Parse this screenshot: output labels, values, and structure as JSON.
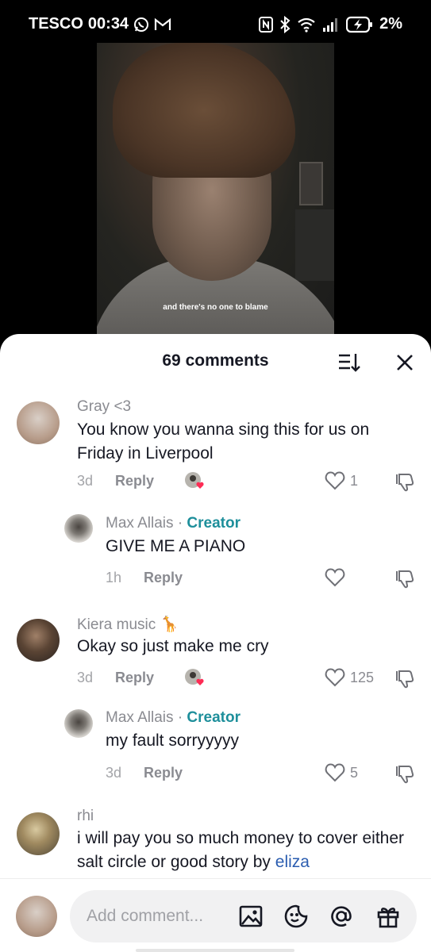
{
  "status_bar": {
    "carrier": "TESCO",
    "time": "00:34",
    "left_icons": [
      "whatsapp-icon",
      "gmail-icon"
    ],
    "right_icons": [
      "nfc-icon",
      "bluetooth-icon",
      "wifi-icon",
      "signal-icon",
      "battery-charging-icon"
    ],
    "battery": "2%"
  },
  "video": {
    "caption": "and there's no one to blame"
  },
  "comments_sheet": {
    "title": "69 comments",
    "sort_icon": "sort-icon",
    "close_icon": "close-icon",
    "comments": [
      {
        "author": "Gray <3",
        "text": "You know you wanna sing this for us on Friday in Liverpool",
        "age": "3d",
        "reply_label": "Reply",
        "creator_liked": true,
        "likes": "1",
        "avatar_color": "#b79c8a"
      },
      {
        "author": "Max Allais",
        "sep": "·",
        "badge": "Creator",
        "text": "GIVE ME A PIANO",
        "age": "1h",
        "reply_label": "Reply",
        "likes": "",
        "avatar_color": "#c9c6c0"
      },
      {
        "author": "Kiera music",
        "author_emoji": "🦒",
        "text": "Okay so just make me cry",
        "age": "3d",
        "reply_label": "Reply",
        "creator_liked": true,
        "likes": "125",
        "avatar_color": "#3a2e26"
      },
      {
        "author": "Max Allais",
        "sep": "·",
        "badge": "Creator",
        "text": "my fault sorryyyyy",
        "age": "3d",
        "reply_label": "Reply",
        "likes": "5",
        "avatar_color": "#c9c6c0"
      },
      {
        "author": "rhi",
        "text": "i will pay you so much money to cover either salt circle or good story by ",
        "mention": "eliza",
        "avatar_color": "#8a7a5a"
      }
    ]
  },
  "input_bar": {
    "placeholder": "Add comment...",
    "icons": [
      "image-icon",
      "sticker-icon",
      "mention-icon",
      "gift-icon"
    ]
  },
  "colors": {
    "creator_badge": "#1e8f9b",
    "mention": "#2b5db0",
    "heart_red": "#fe2c55"
  }
}
